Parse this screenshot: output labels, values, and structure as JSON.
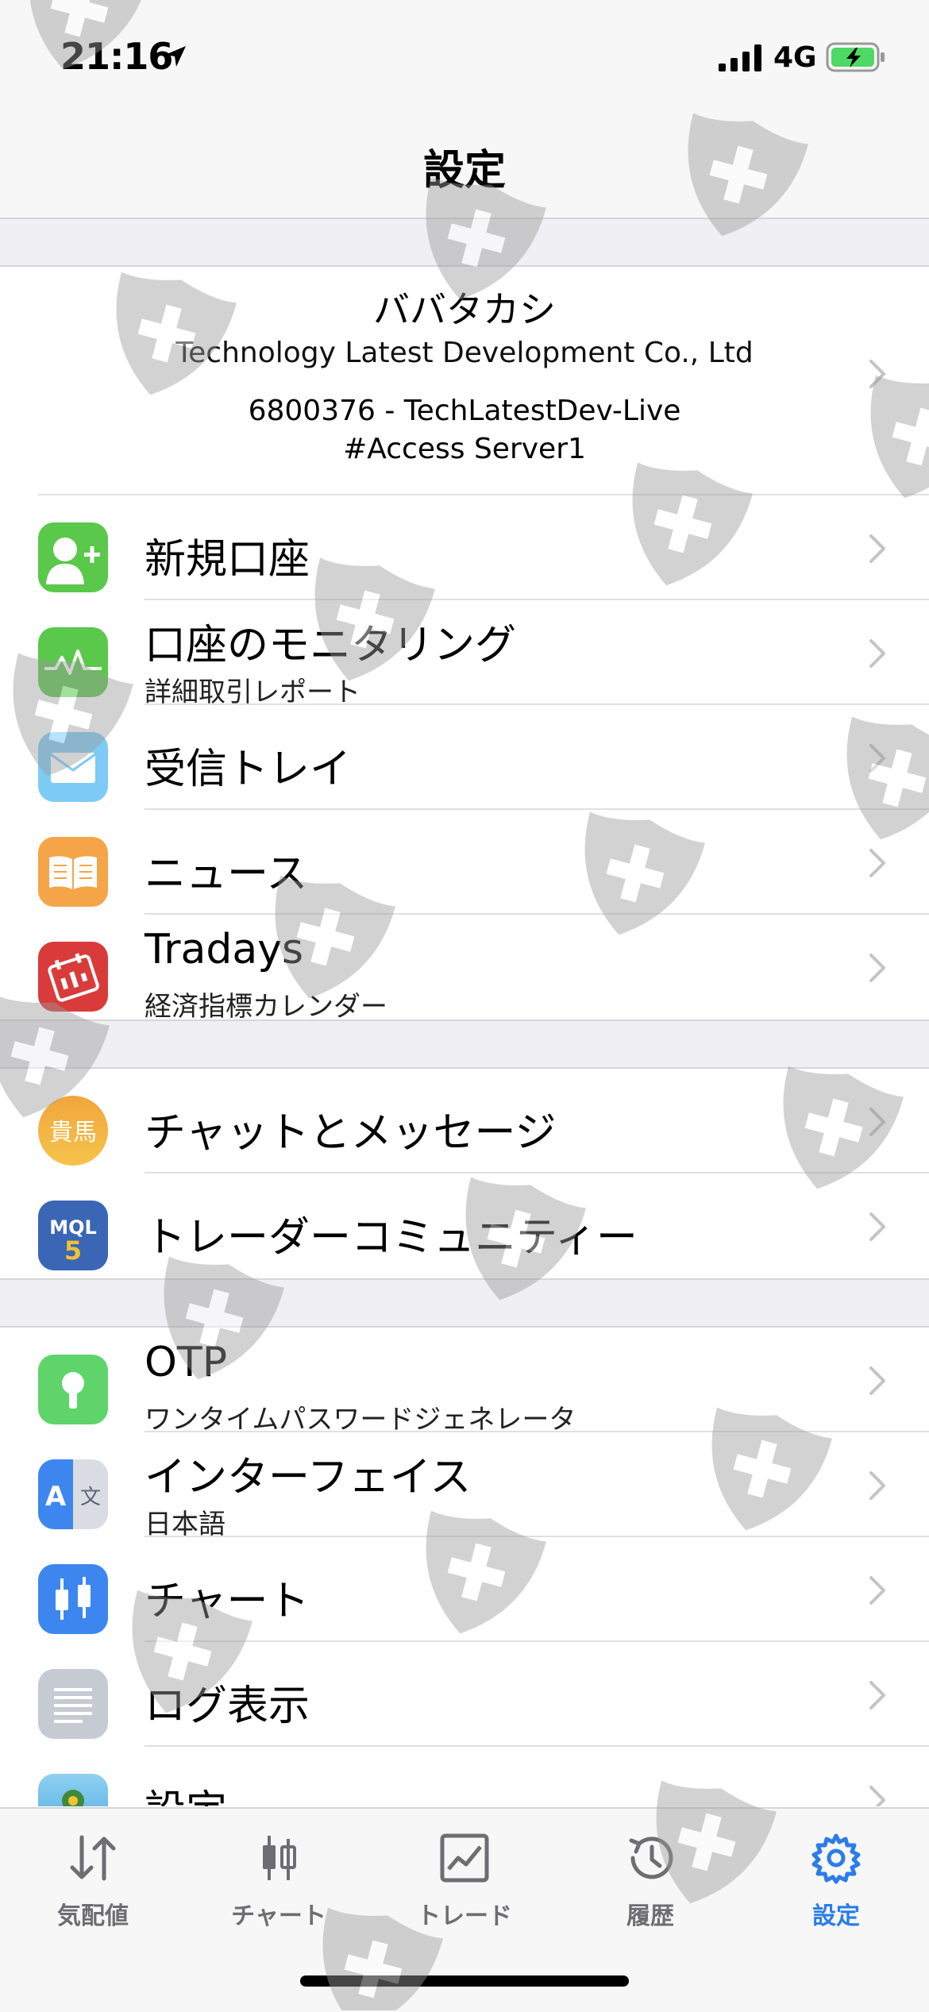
{
  "status": {
    "time": "21:16",
    "network": "4G"
  },
  "nav": {
    "title": "設定"
  },
  "account": {
    "name": "ババタカシ",
    "company": "Technology Latest Development Co., Ltd",
    "number_line": "6800376 - TechLatestDev-Live",
    "server": "#Access Server1"
  },
  "group1": [
    {
      "label": "新規口座",
      "icon": "add-user-icon"
    },
    {
      "label": "口座のモニタリング",
      "sub": "詳細取引レポート",
      "icon": "monitoring-icon"
    },
    {
      "label": "受信トレイ",
      "icon": "mail-icon"
    },
    {
      "label": "ニュース",
      "icon": "book-icon"
    },
    {
      "label": "Tradays",
      "sub": "経済指標カレンダー",
      "icon": "tradays-icon"
    }
  ],
  "group2": [
    {
      "label": "チャットとメッセージ",
      "icon": "chat-avatar-icon",
      "avatar_text": "貴馬"
    },
    {
      "label": "トレーダーコミュニティー",
      "icon": "mql5-icon",
      "badge_text": "MQL5"
    }
  ],
  "group3": [
    {
      "label": "OTP",
      "sub": "ワンタイムパスワードジェネレータ",
      "icon": "otp-lock-icon"
    },
    {
      "label": "インターフェイス",
      "sub": "日本語",
      "icon": "translate-icon"
    },
    {
      "label": "チャート",
      "icon": "candlestick-icon"
    },
    {
      "label": "ログ表示",
      "icon": "log-icon"
    },
    {
      "label": "設定",
      "icon": "metatrader-icon"
    }
  ],
  "tabs": [
    {
      "label": "気配値",
      "icon": "quotes-arrows-icon"
    },
    {
      "label": "チャート",
      "icon": "chart-bars-icon"
    },
    {
      "label": "トレード",
      "icon": "trade-chart-icon"
    },
    {
      "label": "履歴",
      "icon": "history-clock-icon"
    },
    {
      "label": "設定",
      "icon": "settings-gear-icon",
      "active": true
    }
  ],
  "colors": {
    "accent": "#2b7de9",
    "green": "#5ac84a",
    "mail": "#7ecbf5",
    "news": "#f5a547",
    "tradays": "#d93b3b",
    "mql5": "#3a66b5"
  }
}
